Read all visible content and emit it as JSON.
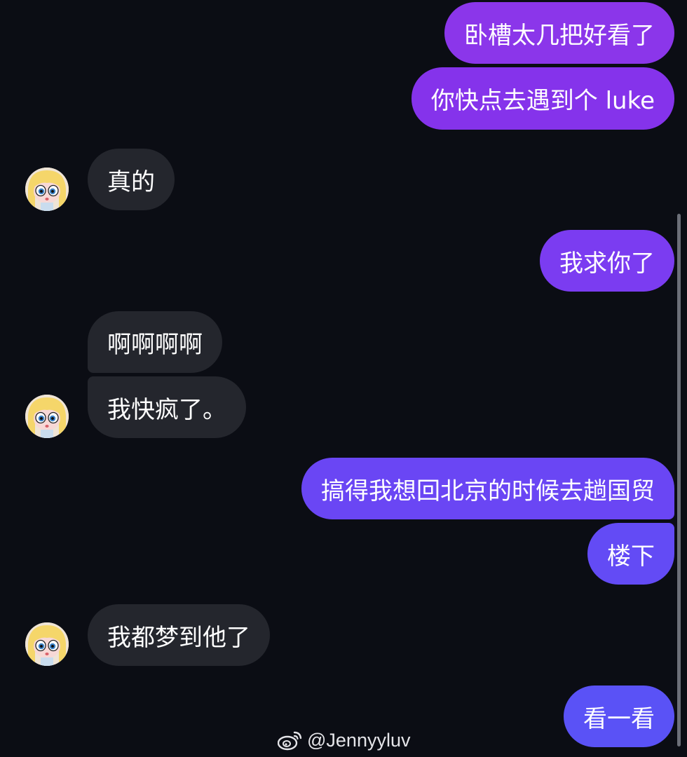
{
  "chat": {
    "messages": [
      {
        "side": "out",
        "text": "卧槽太几把好看了",
        "color": "#8b36ea"
      },
      {
        "side": "out",
        "text": "你快点去遇到个 luke",
        "color": "#8533eb"
      },
      {
        "side": "in",
        "text": "真的"
      },
      {
        "side": "out",
        "text": "我求你了",
        "color": "#7b3cf1"
      },
      {
        "side": "in",
        "text": "啊啊啊啊"
      },
      {
        "side": "in",
        "text": "我快疯了。"
      },
      {
        "side": "out",
        "text": "搞得我想回北京的时候去趟国贸",
        "color": "#6a46f4"
      },
      {
        "side": "out",
        "text": "楼下",
        "color": "#634bf5"
      },
      {
        "side": "in",
        "text": "我都梦到他了"
      },
      {
        "side": "out",
        "text": "看一看",
        "color": "#5a52f6"
      }
    ]
  },
  "avatar": {
    "icon": "cartoon-girl-avatar"
  },
  "watermark": {
    "text": "@Jennyyluv",
    "icon": "weibo-icon"
  }
}
